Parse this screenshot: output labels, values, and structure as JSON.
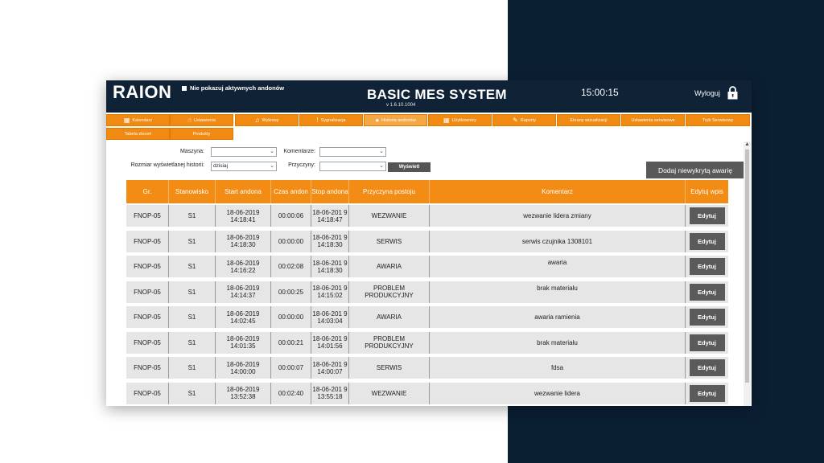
{
  "header": {
    "logo": "RAION",
    "andon_toggle_label": "Nie pokazuj aktywnych andonów",
    "title": "BASIC MES SYSTEM",
    "version": "v 1.6.10.1004",
    "clock": "15:00:15",
    "logout_label": "Wyloguj",
    "lock_icon": "lock-icon"
  },
  "nav": {
    "items": [
      {
        "label": "Kalendarz",
        "icon": "calendar-icon"
      },
      {
        "label": "Ustawienia",
        "icon": "hand-pointer-icon"
      },
      {
        "label": "Wykresy",
        "icon": "music-note-icon"
      },
      {
        "label": "Sygnalizacja",
        "icon": "exclamation-icon"
      },
      {
        "label": "Historia andonów",
        "icon": "user-icon"
      },
      {
        "label": "Użytkownicy",
        "icon": "calendar-icon"
      },
      {
        "label": "Raporty",
        "icon": "wrench-icon"
      },
      {
        "label": "Ekrany wizualizacji",
        "icon": ""
      },
      {
        "label": "Ustawienia serwisowe",
        "icon": ""
      },
      {
        "label": "Tryb Serwisowy",
        "icon": ""
      },
      {
        "label": "Tabela zleceń",
        "icon": ""
      },
      {
        "label": "Produkty",
        "icon": ""
      }
    ]
  },
  "filters": {
    "machine_label": "Maszyna:",
    "machine_value": "",
    "comments_label": "Komentarze:",
    "comments_value": "",
    "history_size_label": "Rozmiar wyświetlanej historii:",
    "history_size_value": "dzisiaj",
    "reasons_label": "Przyczyny:",
    "reasons_value": "",
    "show_button": "Wyświetl",
    "add_button": "Dodaj niewykrytą awarię"
  },
  "table": {
    "headers": [
      "Gr.",
      "Stanowisko",
      "Start andona",
      "Czas andon",
      "Stop andona",
      "Przyczyna postoju",
      "Komentarz",
      "Edytuj wpis"
    ],
    "edit_label": "Edytuj",
    "rows": [
      {
        "group": "FNOP-05",
        "station": "S1",
        "start": "18-06-2019 14:18:41",
        "duration": "00:00:06",
        "stop": "18-06-201 9 14:18:47",
        "reason": "WEZWANIE",
        "comment": "wezwanie lidera zmiany"
      },
      {
        "group": "FNOP-05",
        "station": "S1",
        "start": "18-06-2019 14:18:30",
        "duration": "00:00:00",
        "stop": "18-06-201 9 14:18:30",
        "reason": "SERWIS",
        "comment": "serwis czujnika 1308101"
      },
      {
        "group": "FNOP-05",
        "station": "S1",
        "start": "18-06-2019 14:16:22",
        "duration": "00:02:08",
        "stop": "18-06-201 9 14:18:30",
        "reason": "AWARIA",
        "comment": "awaria"
      },
      {
        "group": "FNOP-05",
        "station": "S1",
        "start": "18-06-2019 14:14:37",
        "duration": "00:00:25",
        "stop": "18-06-201 9 14:15:02",
        "reason": "PROBLEM PRODUKCYJNY",
        "comment": "brak materiału"
      },
      {
        "group": "FNOP-05",
        "station": "S1",
        "start": "18-06-2019 14:02:45",
        "duration": "00:00:00",
        "stop": "18-06-201 9 14:03:04",
        "reason": "AWARIA",
        "comment": "awaria ramienia"
      },
      {
        "group": "FNOP-05",
        "station": "S1",
        "start": "18-06-2019 14:01:35",
        "duration": "00:00:21",
        "stop": "18-06-201 9 14:01:56",
        "reason": "PROBLEM PRODUKCYJNY",
        "comment": "brak materiału"
      },
      {
        "group": "FNOP-05",
        "station": "S1",
        "start": "18-06-2019 14:00:00",
        "duration": "00:00:07",
        "stop": "18-06-201 9 14:00:07",
        "reason": "SERWIS",
        "comment": "fdsa"
      },
      {
        "group": "FNOP-05",
        "station": "S1",
        "start": "18-06-2019 13:52:38",
        "duration": "00:02:40",
        "stop": "18-06-201 9 13:55:18",
        "reason": "WEZWANIE",
        "comment": "wezwanie lidera"
      }
    ]
  },
  "colors": {
    "header_bg": "#0f2236",
    "accent": "#f28c14",
    "row_bg": "#e6e6e6",
    "button_dark": "#5a5a5a"
  }
}
